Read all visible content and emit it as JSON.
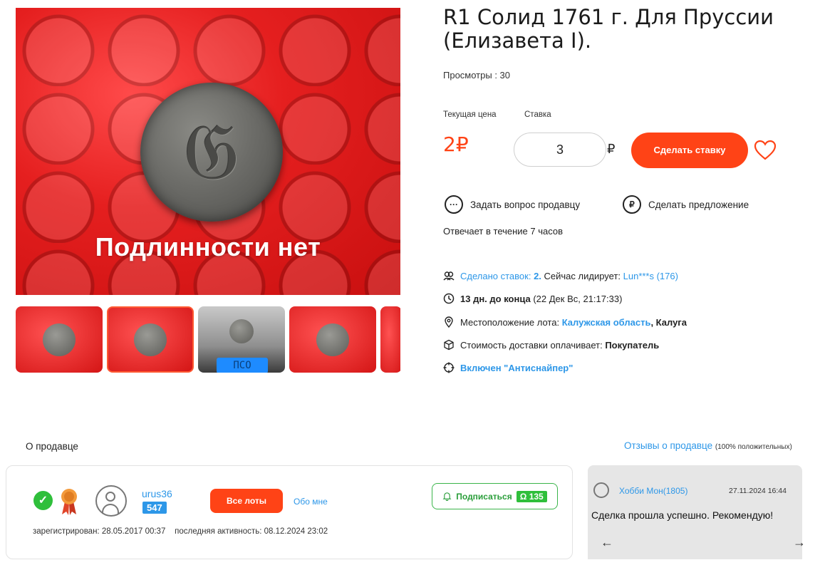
{
  "lot": {
    "title": "R1 Солид 1761 г. Для Пруссии (Елизавета I).",
    "photo_watermark": "Подлинности нет",
    "views": "Просмотры : 30",
    "current_price_label": "Текущая цена",
    "bid_label": "Ставка",
    "current_price": "2₽",
    "bid_value": "3",
    "currency": "₽",
    "bid_button": "Сделать ставку",
    "ask_seller": "Задать вопрос продавцу",
    "make_offer": "Сделать предложение",
    "response_time": "Отвечает в течение 7 часов",
    "scale_display": "ПСО"
  },
  "details": {
    "bids_link": "Сделано ставок: ",
    "bids_count": "2.",
    "leader_label": " Сейчас лидирует: ",
    "leader": "Lun***s (176)",
    "days_left": "13 дн. до конца",
    "end_date": " (22 Дек Вс, 21:17:33)",
    "location_label": "Местоположение лота: ",
    "region": "Калужская область",
    "city": ", Калуга",
    "shipping_label": "Стоимость доставки оплачивает: ",
    "shipping_payer": "Покупатель",
    "antisniper": "Включен \"Антиснайпер\""
  },
  "seller": {
    "section_title": "О продавце",
    "reviews_link": "Отзывы о продавце",
    "reviews_positive": "(100% положительных)",
    "username": "urus36",
    "rating": "547",
    "all_lots": "Все лоты",
    "about_me": "Обо мне",
    "subscribe": "Подписаться",
    "subscribers": "135",
    "registered": "зарегистрирован: 28.05.2017 00:37",
    "last_activity": "последняя активность: 08.12.2024 23:02"
  },
  "review": {
    "author": "Хобби Мон(1805)",
    "date": "27.11.2024 16:44",
    "text": "Сделка прошла успешно. Рекомендую!"
  },
  "colors": {
    "accent": "#ff4316",
    "link": "#2d97e8",
    "success": "#2fbf3b"
  }
}
